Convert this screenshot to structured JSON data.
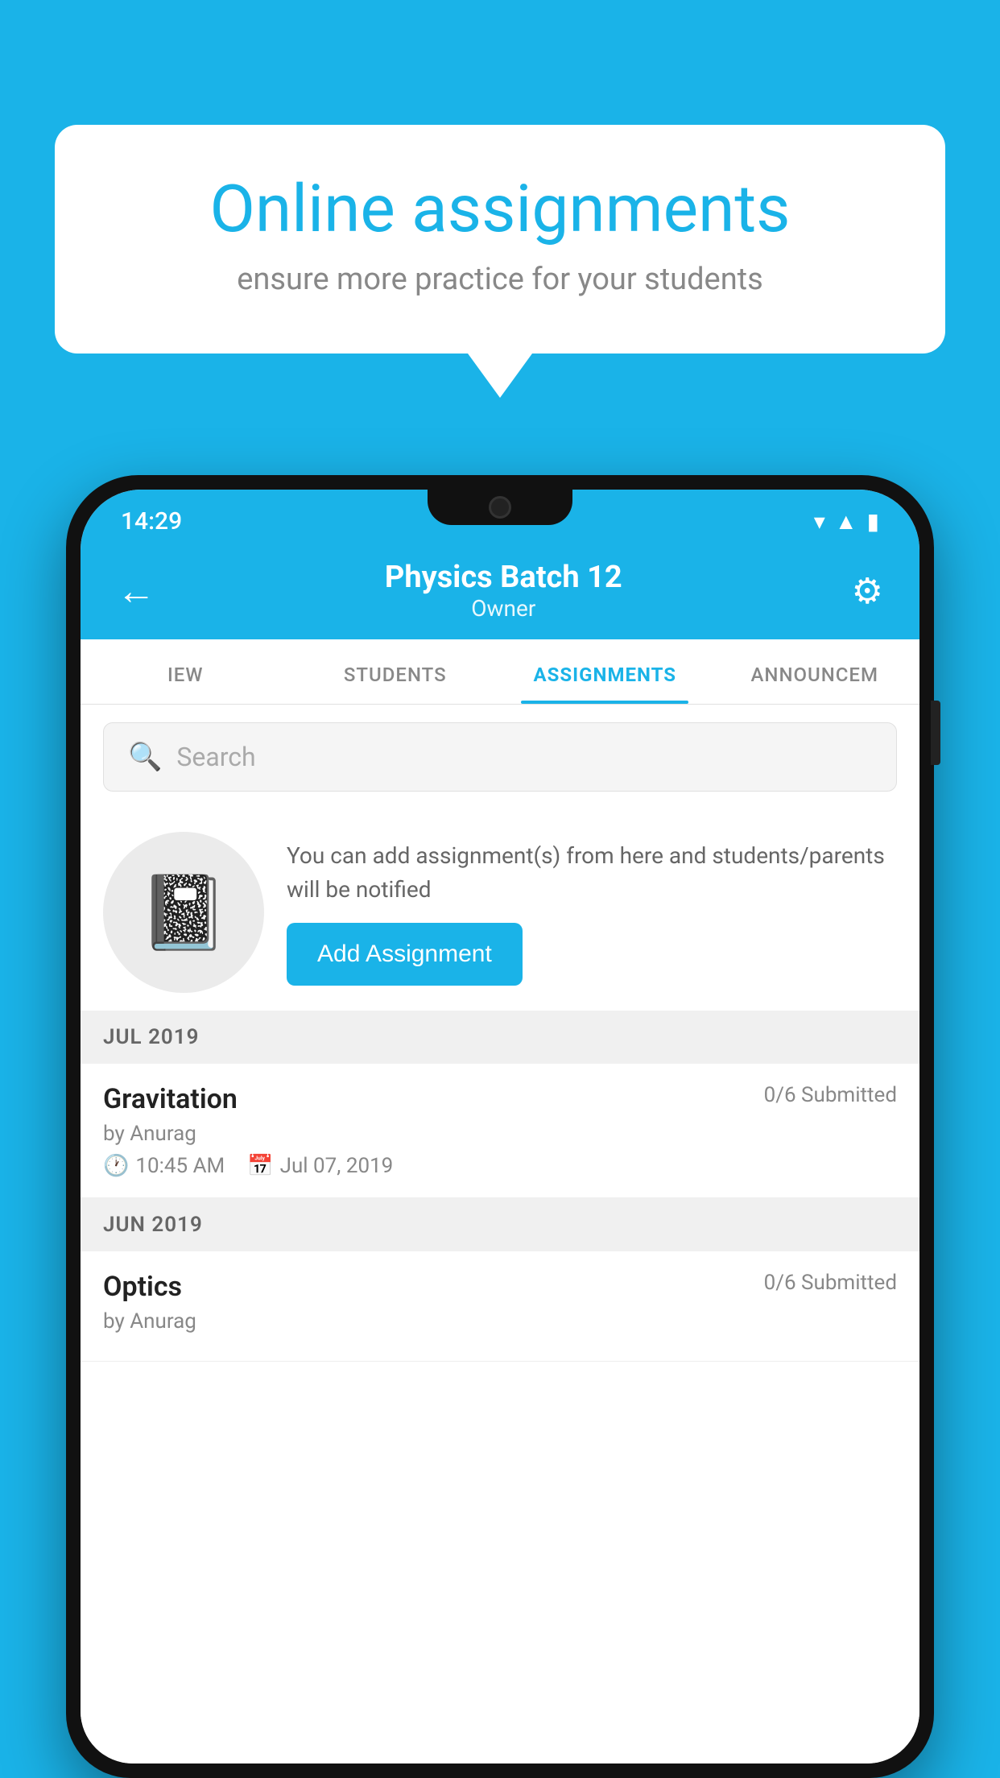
{
  "background_color": "#1ab3e8",
  "speech_bubble": {
    "title": "Online assignments",
    "subtitle": "ensure more practice for your students"
  },
  "status_bar": {
    "time": "14:29",
    "icons": [
      "wifi",
      "signal",
      "battery"
    ]
  },
  "header": {
    "title": "Physics Batch 12",
    "subtitle": "Owner",
    "back_label": "←",
    "settings_label": "⚙"
  },
  "tabs": [
    {
      "label": "IEW",
      "active": false
    },
    {
      "label": "STUDENTS",
      "active": false
    },
    {
      "label": "ASSIGNMENTS",
      "active": true
    },
    {
      "label": "ANNOUNCEM",
      "active": false
    }
  ],
  "search": {
    "placeholder": "Search"
  },
  "promo": {
    "description": "You can add assignment(s) from here and students/parents will be notified",
    "button_label": "Add Assignment"
  },
  "sections": [
    {
      "label": "JUL 2019",
      "assignments": [
        {
          "name": "Gravitation",
          "submitted": "0/6 Submitted",
          "author": "by Anurag",
          "time": "10:45 AM",
          "date": "Jul 07, 2019"
        }
      ]
    },
    {
      "label": "JUN 2019",
      "assignments": [
        {
          "name": "Optics",
          "submitted": "0/6 Submitted",
          "author": "by Anurag",
          "time": "",
          "date": ""
        }
      ]
    }
  ]
}
